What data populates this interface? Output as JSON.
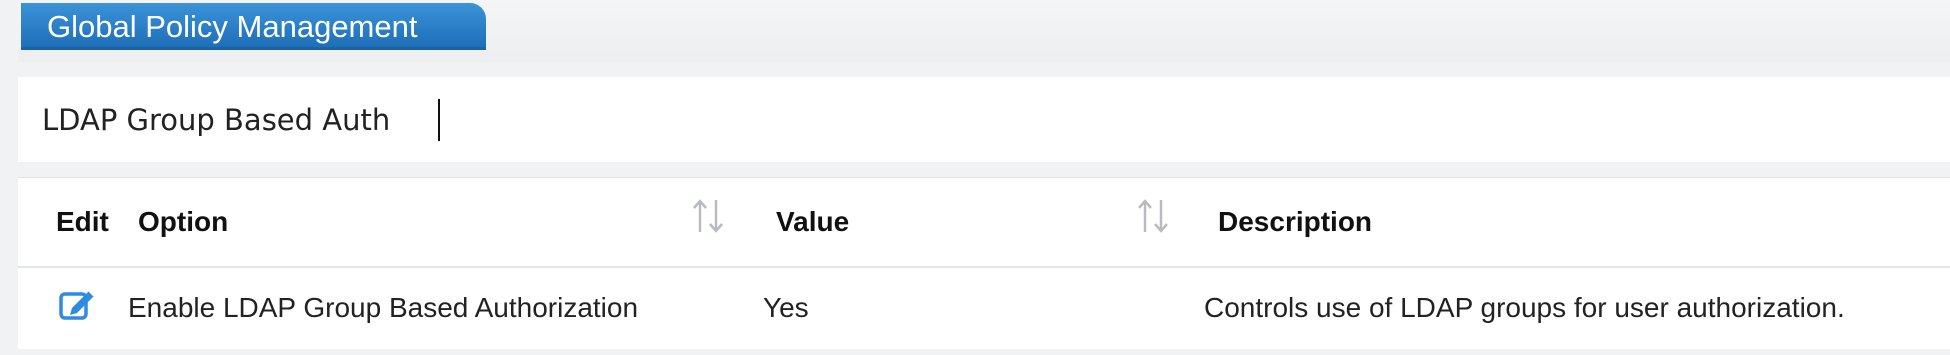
{
  "tab": {
    "label": "Global Policy Management"
  },
  "search": {
    "value": "LDAP Group Based Auth"
  },
  "table": {
    "columns": {
      "edit": "Edit",
      "option": "Option",
      "value": "Value",
      "description": "Description"
    },
    "rows": [
      {
        "option": "Enable LDAP Group Based Authorization",
        "value": "Yes",
        "description": "Controls use of LDAP groups for user authorization."
      }
    ]
  },
  "icons": {
    "sort": "sort-arrows-icon",
    "edit": "edit-pencil-icon"
  },
  "colors": {
    "tab_accent": "#2a80c8",
    "edit_icon": "#2f8be0",
    "sort_icon": "#b8bcc0"
  }
}
